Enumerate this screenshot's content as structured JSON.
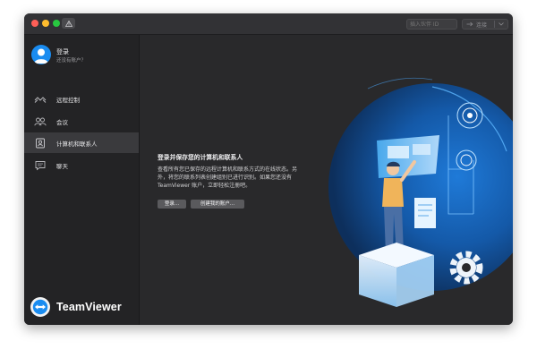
{
  "toolbar": {
    "partner_id_placeholder": "插入伙伴 ID",
    "connect_label": "连接"
  },
  "account": {
    "title": "登录",
    "subtitle": "还没有账户？"
  },
  "sidebar": {
    "items": [
      {
        "label": "远程控制",
        "icon": "remote-control-icon"
      },
      {
        "label": "会议",
        "icon": "meeting-icon"
      },
      {
        "label": "计算机和联系人",
        "icon": "contacts-icon"
      },
      {
        "label": "聊天",
        "icon": "chat-icon"
      }
    ],
    "active_index": 2
  },
  "brand": {
    "name": "TeamViewer"
  },
  "main": {
    "heading": "登录并保存您的计算机和联系人",
    "description": "查看所有您已保存的远程计算机和联系方式的在线状态。另外，将您的联系列表创建组别已进行识别。如果您还没有 TeamViewer 账户，立即轻松注册吧。",
    "login_button": "登录...",
    "create_button": "创建我的账户..."
  },
  "colors": {
    "accent": "#1a8cf0",
    "window_bg": "#29292b",
    "sidebar_bg": "#232325",
    "active_item": "#3a3a3d"
  }
}
